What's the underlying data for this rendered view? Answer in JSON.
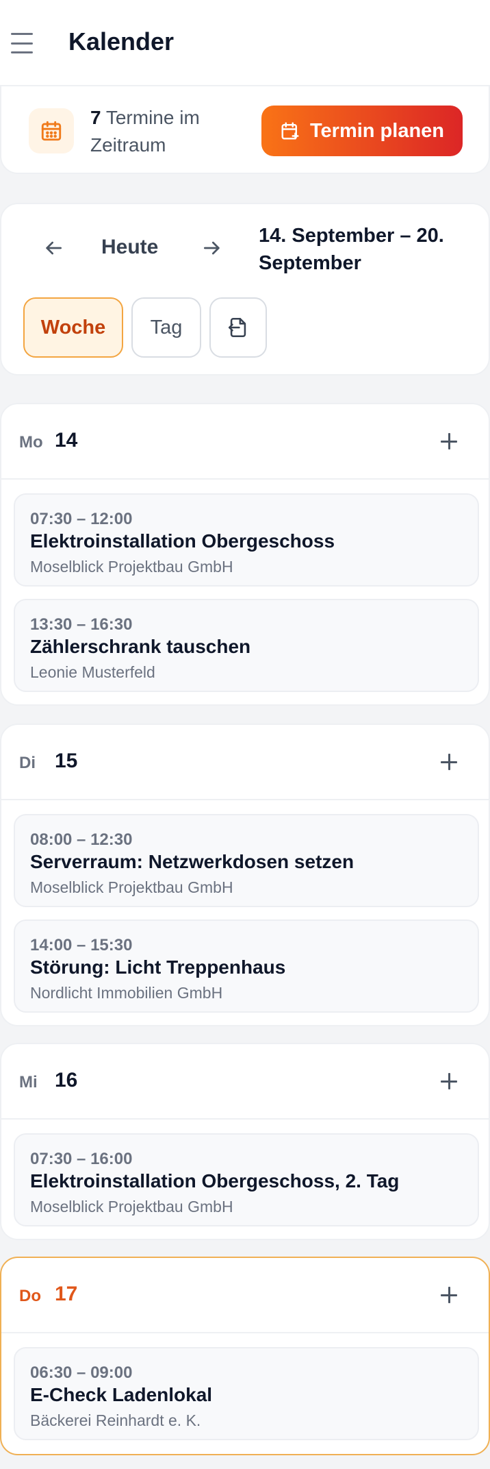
{
  "header": {
    "title": "Kalender",
    "menu_icon": "hamburger-menu-icon"
  },
  "summary": {
    "count": "7",
    "count_text": " Termine im Zeitraum",
    "icon": "calendar-icon",
    "plan_button_label": "Termin planen",
    "plan_button_icon": "calendar-plus-icon"
  },
  "navigation": {
    "prev_icon": "arrow-left-icon",
    "today_label": "Heute",
    "next_icon": "arrow-right-icon",
    "range_label": "14. September – 20. September",
    "views": [
      {
        "label": "Woche",
        "active": true
      },
      {
        "label": "Tag",
        "active": false
      }
    ],
    "export_icon": "file-export-icon"
  },
  "days": [
    {
      "abbr": "Mo",
      "num": "14",
      "today": false,
      "events": [
        {
          "time": "07:30 – 12:00",
          "title": "Elektroinstallation Obergeschoss",
          "client": "Moselblick Projektbau GmbH"
        },
        {
          "time": "13:30 – 16:30",
          "title": "Zählerschrank tauschen",
          "client": "Leonie Musterfeld"
        }
      ]
    },
    {
      "abbr": "Di",
      "num": "15",
      "today": false,
      "events": [
        {
          "time": "08:00 – 12:30",
          "title": "Serverraum: Netzwerkdosen setzen",
          "client": "Moselblick Projektbau GmbH"
        },
        {
          "time": "14:00 – 15:30",
          "title": "Störung: Licht Treppenhaus",
          "client": "Nordlicht Immobilien GmbH"
        }
      ]
    },
    {
      "abbr": "Mi",
      "num": "16",
      "today": false,
      "events": [
        {
          "time": "07:30 – 16:00",
          "title": "Elektroinstallation Obergeschoss, 2. Tag",
          "client": "Moselblick Projektbau GmbH"
        }
      ]
    },
    {
      "abbr": "Do",
      "num": "17",
      "today": true,
      "events": [
        {
          "time": "06:30 – 09:00",
          "title": "E‑Check Ladenlokal",
          "client": "Bäckerei Reinhardt e. K."
        }
      ]
    }
  ],
  "colors": {
    "accent": "#f97316",
    "accent_end": "#dc2626",
    "today": "#e0571a"
  }
}
